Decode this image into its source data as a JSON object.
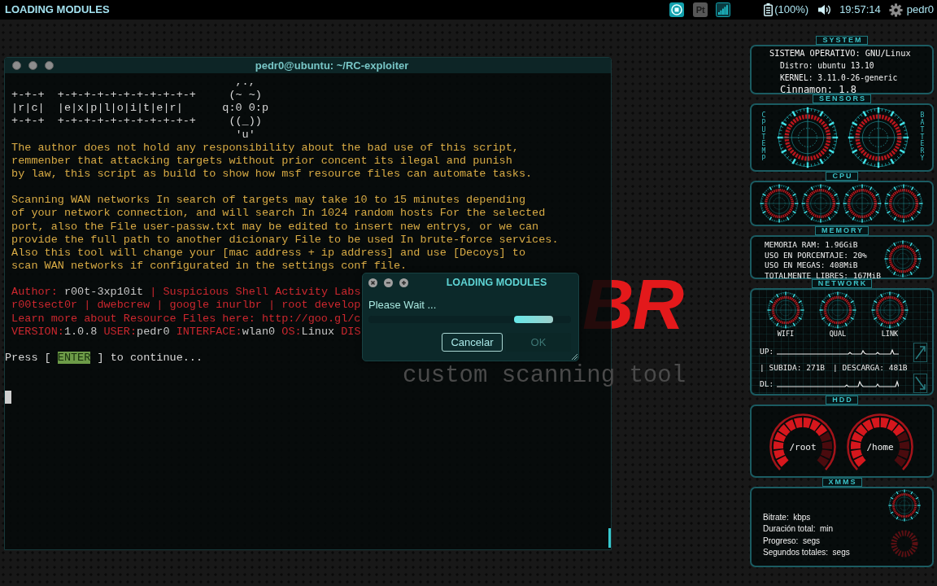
{
  "top_panel": {
    "title": "LOADING MODULES",
    "badge": "Pt",
    "battery": "(100%)",
    "clock": "19:57:14",
    "user": "pedr0"
  },
  "wallpaper": {
    "logo": "BR",
    "tagline": "custom scanning tool"
  },
  "terminal": {
    "title": "pedr0@ubuntu: ~/RC-exploiter",
    "banner": [
      "+-+-+  +-+-+-+-+-+-+-+-+-+-+",
      "|r|c|  |e|x|p|l|o|i|t|e|r|",
      "+-+-+  +-+-+-+-+-+-+-+-+-+-+"
    ],
    "mascot": [
      ",.,",
      "(~ ~)",
      "q:0 0:p",
      "((_))",
      "'u'"
    ],
    "notice": [
      "The author does not hold any responsibility about the bad use of this script,",
      "remmenber that attacking targets without prior concent its ilegal and punish",
      "by law, this script as build to show how msf resource files can automate tasks."
    ],
    "description": [
      "Scanning WAN networks In search of targets may take 10 to 15 minutes depending",
      "of your network connection, and will search In 1024 random hosts For the selected",
      "port, also the File user-passw.txt may be edited to insert new entrys, or we can",
      "provide the full path to another dicionary File to be used In brute-force services.",
      "Also this tool will change your [mac address + ip address] and use [Decoys] to",
      "scan WAN networks if configurated in the settings conf file."
    ],
    "credits": [
      [
        {
          "text": "Author:",
          "kind": "label"
        },
        {
          "text": " r00t-3xp10it",
          "kind": "value"
        },
        {
          "text": " | Suspicious Shell Activity Labs",
          "kind": "label"
        }
      ],
      [
        {
          "text": "r00tsect0r | dwebcrew | google inurlbr | root develop",
          "kind": "label"
        }
      ],
      [
        {
          "text": "Learn more about Resource Files here: http://goo.gl/c",
          "kind": "label"
        }
      ],
      [
        {
          "text": "VERSION:",
          "kind": "label"
        },
        {
          "text": "1.0.8",
          "kind": "value"
        },
        {
          "text": " USER:",
          "kind": "label"
        },
        {
          "text": "pedr0",
          "kind": "value"
        },
        {
          "text": " INTERFACE:",
          "kind": "label"
        },
        {
          "text": "wlan0",
          "kind": "value"
        },
        {
          "text": " OS:",
          "kind": "label"
        },
        {
          "text": "Linux",
          "kind": "value"
        },
        {
          "text": " DIS",
          "kind": "label"
        }
      ]
    ],
    "prompt": {
      "before": "Press [ ",
      "key": "ENTER",
      "after": " ] to continue..."
    }
  },
  "dialog": {
    "title": "LOADING MODULES",
    "message": "Please Wait ...",
    "progress": {
      "indeterminate": true
    },
    "buttons": [
      {
        "label": "Cancelar",
        "focused": true,
        "disabled": false
      },
      {
        "label": "OK",
        "focused": false,
        "disabled": true
      }
    ]
  },
  "conky": {
    "sections": [
      {
        "kind": "system",
        "title": "SYSTEM",
        "lines": [
          "SISTEMA OPERATIVO: GNU/Linux",
          "Distro: ubuntu 13.10",
          "KERNEL: 3.11.0-26-generic",
          "Cinnamon: 1.8"
        ]
      },
      {
        "kind": "sensors",
        "title": "SENSORS",
        "left_label": "CPUTEMP",
        "right_label": "BATTERY"
      },
      {
        "kind": "cpu",
        "title": "CPU"
      },
      {
        "kind": "memory",
        "title": "MEMORY",
        "lines": [
          "MEMORIA RAM: 1.96GiB",
          "USO EN PORCENTAJE: 20%",
          "USO EN MEGAS: 408MiB",
          "TOTALMENTE LIBRES: 167MiB"
        ]
      },
      {
        "kind": "network",
        "title": "NETWORK",
        "gauges": [
          "WIFI",
          "QUAL",
          "LINK"
        ],
        "up_label": "UP:",
        "totals": [
          "| SUBIDA: 271B",
          "| DESCARGA: 481B"
        ],
        "down_label": "DL:"
      },
      {
        "kind": "hdd",
        "title": "HDD",
        "meters": [
          {
            "label": "/root",
            "segments": [
              {
                "on": true
              },
              {
                "on": true
              },
              {
                "on": true
              },
              {
                "on": true
              },
              {
                "on": true
              },
              {
                "on": true
              },
              {
                "on": true
              },
              {
                "on": true
              },
              {
                "on": true
              },
              {
                "on": true
              },
              {
                "on": false
              },
              {
                "on": false
              },
              {
                "on": false
              },
              {
                "on": false
              }
            ]
          },
          {
            "label": "/home",
            "segments": [
              {
                "on": true
              },
              {
                "on": true
              },
              {
                "on": true
              },
              {
                "on": true
              },
              {
                "on": true
              },
              {
                "on": true
              },
              {
                "on": true
              },
              {
                "on": true
              },
              {
                "on": true
              },
              {
                "on": true
              },
              {
                "on": false
              },
              {
                "on": false
              },
              {
                "on": false
              },
              {
                "on": false
              }
            ]
          }
        ]
      },
      {
        "kind": "xmms",
        "title": "XMMS",
        "lines": [
          "Bitrate:  kbps",
          "Duración total:  min",
          "Progreso:  segs",
          "Segundos totales:  segs"
        ]
      }
    ]
  }
}
